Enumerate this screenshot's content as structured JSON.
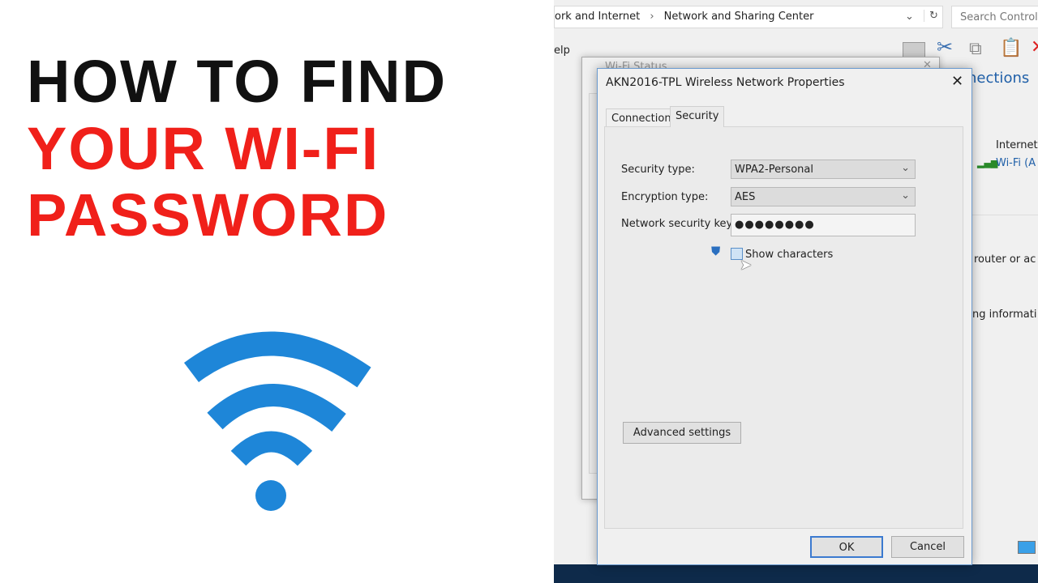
{
  "headline": {
    "line1": "HOW TO FIND",
    "line2": "YOUR WI-FI",
    "line3": "PASSWORD",
    "color_black": "#111111",
    "color_red": "#f0201a"
  },
  "wifi_icon": {
    "name": "wifi-icon",
    "color": "#1e86d8"
  },
  "explorer": {
    "breadcrumb": [
      "ork and Internet",
      "Network and Sharing Center"
    ],
    "breadcrumb_sep": "›",
    "search_placeholder": "Search Control",
    "menu_help": "elp",
    "connections_link": "nections",
    "internet_label": "Internet",
    "wifi_link": "Wi-Fi (A",
    "text_router": "router or ac",
    "text_info": "ng informati"
  },
  "wifi_status": {
    "title": "Wi-Fi Status"
  },
  "dialog": {
    "title": "AKN2016-TPL Wireless Network Properties",
    "tabs": [
      {
        "label": "Connection",
        "active": false
      },
      {
        "label": "Security",
        "active": true
      }
    ],
    "security_type_label": "Security type:",
    "security_type_value": "WPA2-Personal",
    "encryption_type_label": "Encryption type:",
    "encryption_type_value": "AES",
    "key_label": "Network security key",
    "key_value": "●●●●●●●●",
    "show_characters_label": "Show characters",
    "show_characters_checked": false,
    "advanced_button": "Advanced settings",
    "ok_button": "OK",
    "cancel_button": "Cancel"
  }
}
